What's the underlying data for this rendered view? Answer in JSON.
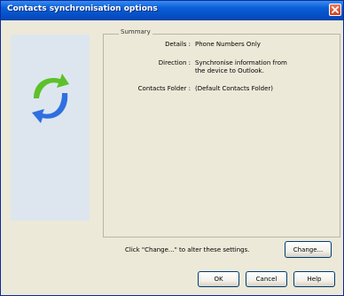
{
  "window": {
    "title": "Contacts synchronisation options"
  },
  "summary": {
    "legend": "Summary",
    "details_label": "Details :",
    "details_value": "Phone Numbers Only",
    "direction_label": "Direction :",
    "direction_value_line1": "Synchronise information from",
    "direction_value_line2": "the device to Outlook.",
    "folder_label": "Contacts Folder :",
    "folder_value": "(Default Contacts Folder)"
  },
  "hint": "Click \"Change...\" to alter these settings.",
  "buttons": {
    "change": "Change...",
    "ok": "OK",
    "cancel": "Cancel",
    "help": "Help"
  },
  "icons": {
    "close": "close-icon",
    "logo": "sync-logo-icon"
  },
  "colors": {
    "title_bar": "#0551c8",
    "close_button": "#d6401c",
    "dialog_background": "#ece9d8",
    "left_panel": "#dde6ee",
    "logo_green": "#5cc12a",
    "logo_blue": "#2f6fe0"
  }
}
